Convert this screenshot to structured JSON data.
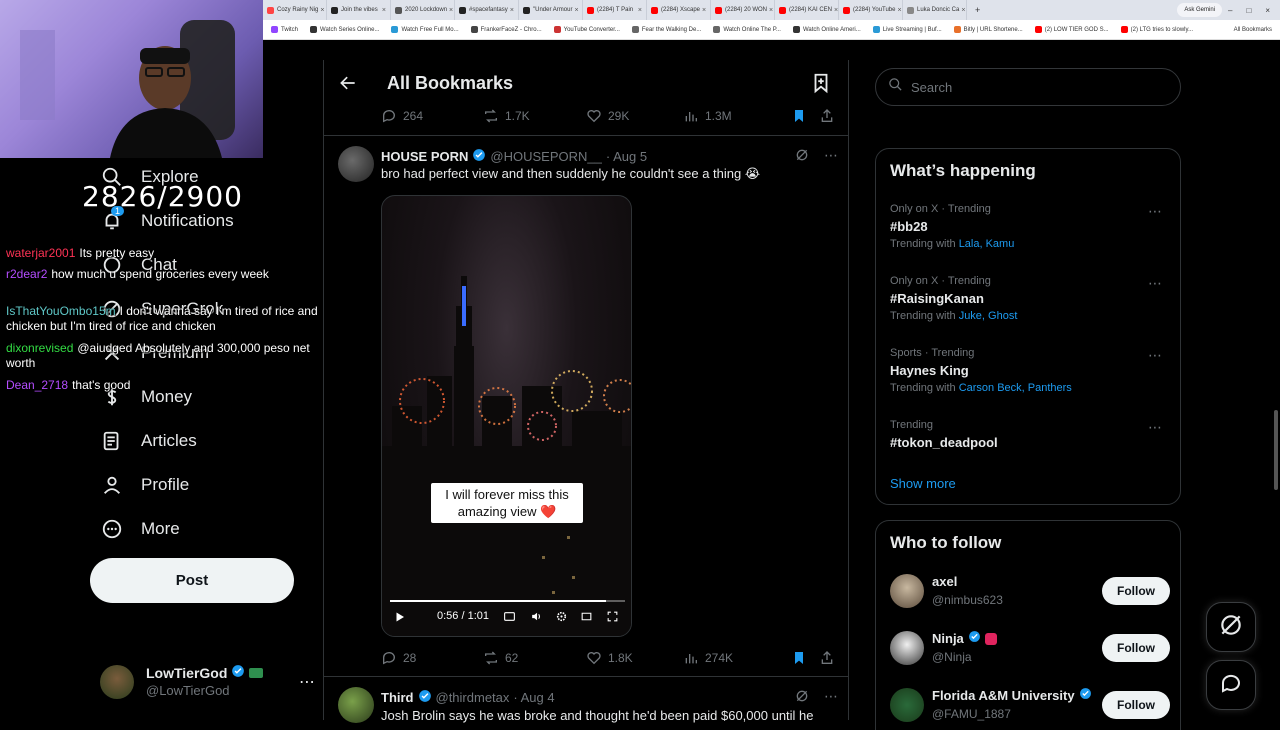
{
  "browser": {
    "tabs": [
      {
        "label": "Cozy Rainy Nig",
        "color": "#ff4444"
      },
      {
        "label": "Join the vibes",
        "color": "#222222"
      },
      {
        "label": "2020 Lockdown",
        "color": "#555555"
      },
      {
        "label": "#spacefantasy",
        "color": "#222222"
      },
      {
        "label": "\"Under Armour",
        "color": "#222222"
      },
      {
        "label": "(2284) T Pain",
        "color": "#ff0000"
      },
      {
        "label": "(2284) Xscape",
        "color": "#ff0000"
      },
      {
        "label": "(2284) 20 WON",
        "color": "#ff0000"
      },
      {
        "label": "(2284) KAI CEN",
        "color": "#ff0000"
      },
      {
        "label": "(2284) YouTube",
        "color": "#ff0000"
      },
      {
        "label": "Luka Doncic Ca",
        "color": "#888888"
      }
    ],
    "new_tab": "+",
    "ask_gemini": "Ask Gemini",
    "bookmarks_bar": [
      {
        "label": "Twitch",
        "color": "#9146ff"
      },
      {
        "label": "Watch Series Online...",
        "color": "#333333"
      },
      {
        "label": "Watch Free Full Mo...",
        "color": "#2a9ad6"
      },
      {
        "label": "FrankerFaceZ - Chro...",
        "color": "#444444"
      },
      {
        "label": "YouTube Converter...",
        "color": "#cc3333"
      },
      {
        "label": "Fear the Walking De...",
        "color": "#666666"
      },
      {
        "label": "Watch Online The P...",
        "color": "#666666"
      },
      {
        "label": "Watch Online Ameri...",
        "color": "#333333"
      },
      {
        "label": "Live Streaming | Buf...",
        "color": "#2a9ad6"
      },
      {
        "label": "Bitly | URL Shortene...",
        "color": "#e8702a"
      },
      {
        "label": "(2) LOW TIER GOD S...",
        "color": "#ff0000"
      },
      {
        "label": "(2) LTG tries to slowly...",
        "color": "#ff0000"
      }
    ],
    "all_bookmarks": "All Bookmarks"
  },
  "overlay": {
    "counter": "2826/2900",
    "chat": [
      {
        "user": "waterjar2001",
        "color": "#ff3355",
        "text": "Its pretty easy"
      },
      {
        "user": "r2dear2",
        "color": "#b44dff",
        "text": "how much u spend groceries every week"
      },
      {
        "user": "IsThatYouOmbo15m",
        "color": "#5fc8c8",
        "text": "I don't wanna say I'm tired of rice and chicken but I'm tired of rice and chicken"
      },
      {
        "user": "dixonrevised",
        "color": "#33dd44",
        "text": "@aiudged Absolutely and 300,000 peso net worth"
      },
      {
        "user": "Dean_2718",
        "color": "#b44dff",
        "text": "that's good"
      }
    ]
  },
  "nav": {
    "explore": "Explore",
    "notifications": "Notifications",
    "notif_count": "1",
    "chat": "Chat",
    "supergrok": "SuperGrok",
    "premium": "Premium",
    "money": "Money",
    "articles": "Articles",
    "profile": "Profile",
    "more": "More",
    "post": "Post"
  },
  "account": {
    "display_name": "LowTierGod",
    "handle": "@LowTierGod"
  },
  "main": {
    "title": "All Bookmarks",
    "prev_tweet": {
      "replies": "264",
      "reposts": "1.7K",
      "likes": "29K",
      "views": "1.3M"
    },
    "tweet1": {
      "name": "HOUSE PORN",
      "handle": "@HOUSEPORN__",
      "date": "· Aug 5",
      "text": "bro had perfect view and then suddenly he couldn't see a thing 😭",
      "caption_line1": "I will forever miss this",
      "caption_line2": "amazing view ❤️",
      "video_time": "0:56 / 1:01",
      "progress": 0.92,
      "replies": "28",
      "reposts": "62",
      "likes": "1.8K",
      "views": "274K"
    },
    "tweet2": {
      "name": "Third",
      "handle": "@thirdmetax",
      "date": "· Aug 4",
      "text": "Josh Brolin says he was broke and thought he'd been paid $60,000 until he"
    }
  },
  "sidebar": {
    "search_placeholder": "Search",
    "whats_happening": "What’s happening",
    "trends": [
      {
        "meta": "Only on X · Trending",
        "name": "#bb28",
        "with_label": "Trending with",
        "with": "Lala, Kamu"
      },
      {
        "meta": "Only on X · Trending",
        "name": "#RaisingKanan",
        "with_label": "Trending with",
        "with": "Juke, Ghost"
      },
      {
        "meta": "Sports · Trending",
        "name": "Haynes King",
        "with_label": "Trending with",
        "with": "Carson Beck, Panthers"
      },
      {
        "meta": "Trending",
        "name": "#tokon_deadpool",
        "with_label": "",
        "with": ""
      }
    ],
    "show_more": "Show more",
    "who_to_follow": "Who to follow",
    "follow": [
      {
        "name": "axel",
        "handle": "@nimbus623",
        "button": "Follow"
      },
      {
        "name": "Ninja",
        "handle": "@Ninja",
        "button": "Follow"
      },
      {
        "name": "Florida A&M University",
        "handle": "@FAMU_1887",
        "button": "Follow"
      }
    ]
  },
  "colors": {
    "accent": "#1d9bf0",
    "verified": "#1d9bf0",
    "bookmark_active": "#1d9bf0"
  }
}
